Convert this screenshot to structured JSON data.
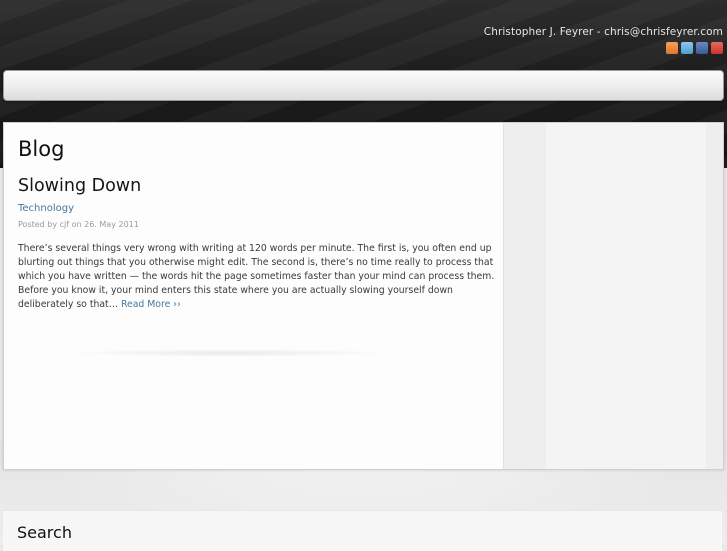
{
  "header": {
    "contact": "Christopher J. Feyrer - chris@chrisfeyrer.com",
    "social_icons": [
      {
        "name": "rss-icon",
        "color": "#e0762b",
        "glyph": "☷"
      },
      {
        "name": "twitter-icon",
        "color": "#5aa9d6",
        "glyph": "t"
      },
      {
        "name": "facebook-icon",
        "color": "#3b5a97",
        "glyph": "f"
      },
      {
        "name": "youtube-icon",
        "color": "#c7352b",
        "glyph": "▶"
      }
    ]
  },
  "page": {
    "title": "Blog"
  },
  "post": {
    "title": "Slowing Down",
    "category": "Technology",
    "meta": "Posted by cjf on 26. May 2011",
    "excerpt": "There’s several things very wrong with writing at 120 words per minute.  The first is, you often end up blurting out things that you otherwise might edit.  The second is, there’s no time really to process that which you have written — the words hit the page sometimes faster than your mind can process them.  Before you know it, your mind enters this state where you are actually slowing yourself down deliberately so that…",
    "read_more": "Read More ››"
  },
  "widgets": {
    "search_title": "Search"
  }
}
